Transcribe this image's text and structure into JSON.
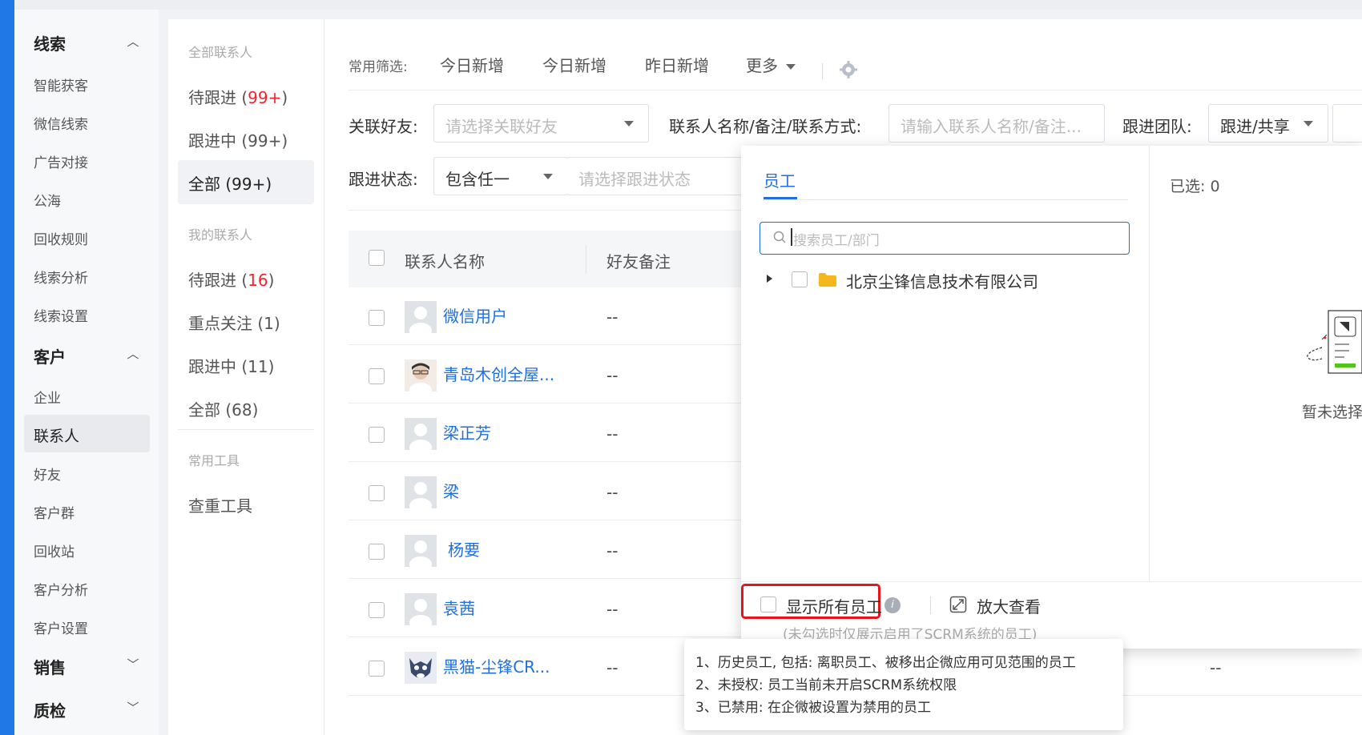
{
  "sidebar": {
    "groups": [
      {
        "label": "线索",
        "items": [
          "智能获客",
          "微信线索",
          "广告对接",
          "公海",
          "回收规则",
          "线索分析",
          "线索设置"
        ]
      },
      {
        "label": "客户",
        "items": [
          "企业",
          "联系人",
          "好友",
          "客户群",
          "回收站",
          "客户分析",
          "客户设置"
        ]
      },
      {
        "label": "销售",
        "items": []
      },
      {
        "label": "质检",
        "items": []
      }
    ]
  },
  "contact_nav": {
    "all_header": "全部联系人",
    "all_pending": {
      "label": "待跟进 (",
      "count": "99+",
      "close": ")"
    },
    "all_following": "跟进中 (99+)",
    "all_all": "全部 (99+)",
    "mine_header": "我的联系人",
    "mine_pending": {
      "label": "待跟进 (",
      "count": "16",
      "close": ")"
    },
    "mine_focus": "重点关注 (1)",
    "mine_following": "跟进中 (11)",
    "mine_all": "全部 (68)",
    "tools_header": "常用工具",
    "dedupe_tool": "查重工具"
  },
  "toolbar": {
    "label": "常用筛选:",
    "filter1": "今日新增",
    "filter2": "今日新增",
    "filter3": "昨日新增",
    "more": "更多"
  },
  "filters": {
    "friend_label": "关联好友:",
    "friend_placeholder": "请选择关联好友",
    "name_label": "联系人名称/备注/联系方式:",
    "name_placeholder": "请输入联系人名称/备注...",
    "team_label": "跟进团队:",
    "team_value": "跟进/共享",
    "status_label": "跟进状态:",
    "status_mode": "包含任一",
    "status_placeholder": "请选择跟进状态"
  },
  "table": {
    "col_name": "联系人名称",
    "col_remark": "好友备注",
    "rows": [
      {
        "name": "微信用户",
        "remark": "--"
      },
      {
        "name": "青岛木创全屋...",
        "remark": "--"
      },
      {
        "name": "梁正芳",
        "remark": "--"
      },
      {
        "name": "梁",
        "remark": "--"
      },
      {
        "name": "杨要",
        "remark": "--"
      },
      {
        "name": "袁茜",
        "remark": "--"
      },
      {
        "name": "黑猫-尘锋CR...",
        "remark": "--"
      }
    ],
    "far_dash": "--"
  },
  "picker": {
    "tab": "员工",
    "search_placeholder": "搜索员工/部门",
    "company": "北京尘锋信息技术有限公司",
    "selected": "已选: 0",
    "empty": "暂未选择",
    "show_all": "显示所有员工",
    "zoom": "放大查看",
    "note": "(未勾选时仅展示启用了SCRM系统的员工)"
  },
  "tooltip": {
    "line1": "1、历史员工, 包括: 离职员工、被移出企微应用可见范围的员工",
    "line2": "2、未授权: 员工当前未开启SCRM系统权限",
    "line3": "3、已禁用: 在企微被设置为禁用的员工"
  },
  "colors": {
    "accent": "#1f6fe0",
    "sidebar_bar": "#1f78e6",
    "count_red": "#f5222d",
    "highlight_border": "#e8141c"
  }
}
